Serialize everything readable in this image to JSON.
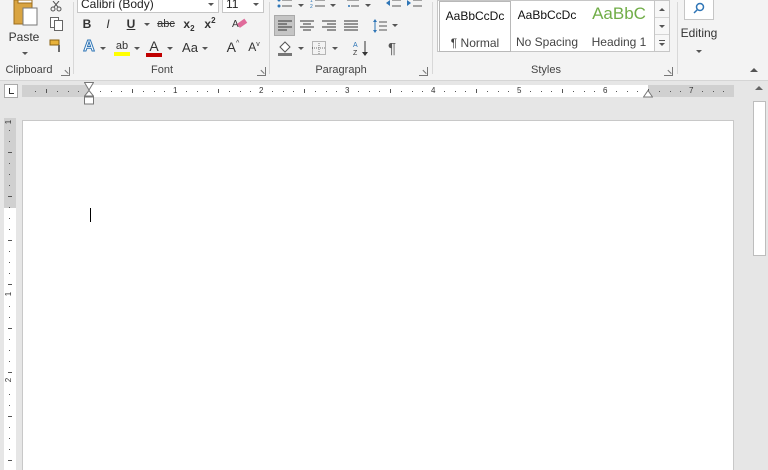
{
  "ribbon": {
    "clipboard": {
      "paste_label": "Paste",
      "group_label": "Clipboard"
    },
    "font": {
      "font_name": "Calibri (Body)",
      "font_size": "11",
      "bold": "B",
      "italic": "I",
      "underline": "U",
      "strikethrough": "abc",
      "subscript": "x",
      "subscript_mark": "2",
      "superscript": "x",
      "superscript_mark": "2",
      "text_effects": "A",
      "highlight": "ab",
      "font_color": "A",
      "change_case": "Aa",
      "grow": "A",
      "shrink": "A",
      "group_label": "Font",
      "highlight_color": "#ffff00",
      "font_color_value": "#c00000"
    },
    "paragraph": {
      "show_marks": "¶",
      "group_label": "Paragraph"
    },
    "styles": {
      "items": [
        {
          "sample": "AaBbCcDc",
          "name": "¶ Normal"
        },
        {
          "sample": "AaBbCcDc",
          "name": "No Spacing"
        },
        {
          "sample": "AaBbC",
          "name": "Heading 1"
        }
      ],
      "heading_color": "#70ad47",
      "group_label": "Styles"
    },
    "editing": {
      "label": "Editing"
    }
  },
  "ruler": {
    "h_numbers": [
      "1",
      "2",
      "3",
      "4",
      "5",
      "6",
      "7"
    ],
    "v_numbers": [
      "1",
      "1",
      "2"
    ]
  }
}
